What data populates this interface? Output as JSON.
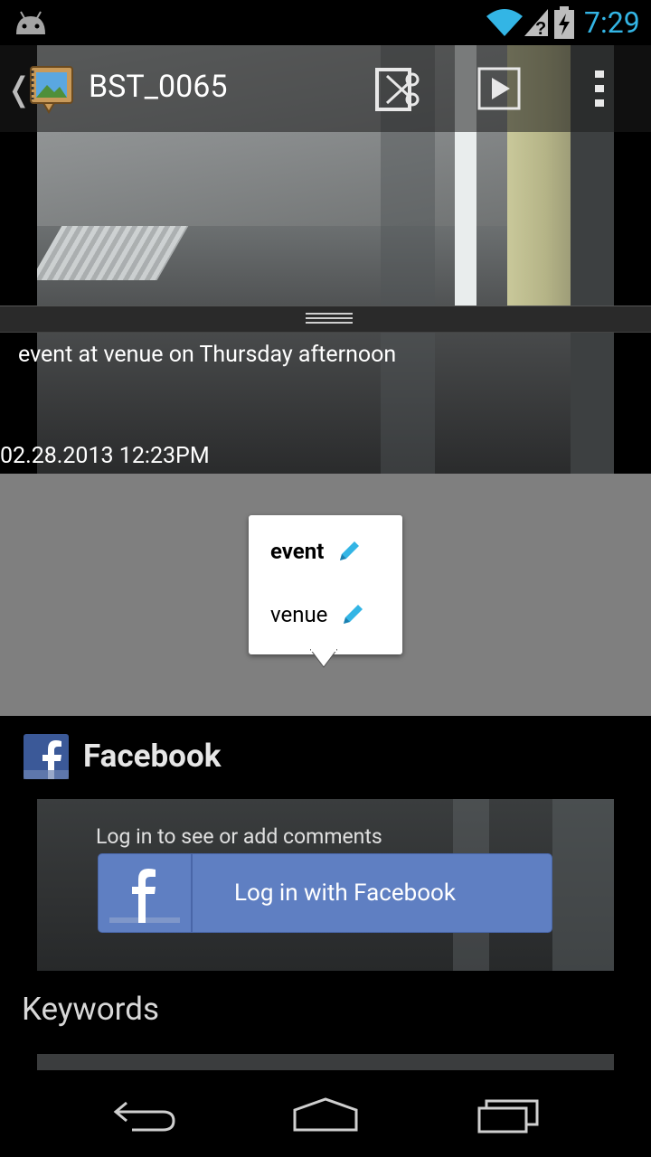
{
  "status_bar": {
    "time": "7:29"
  },
  "action_bar": {
    "title": "BST_0065",
    "back_glyph": "❬"
  },
  "photo": {
    "caption": "event at venue on Thursday afternoon",
    "datetime": "02.28.2013 12:23PM"
  },
  "tags": {
    "items": [
      {
        "label": "event",
        "bold": true
      },
      {
        "label": "venue",
        "bold": false
      }
    ]
  },
  "facebook": {
    "heading": "Facebook",
    "hint": "Log in to see or add comments",
    "login_label": "Log in with Facebook",
    "brand_color": "#3b5998",
    "button_color": "#5f7fc2"
  },
  "keywords": {
    "heading": "Keywords"
  },
  "colors": {
    "accent": "#33b5e5",
    "tag_area": "#7f7f7f"
  },
  "icons": [
    "android-icon",
    "wifi-icon",
    "signal-unknown-icon",
    "battery-charging-icon",
    "gallery-app-icon",
    "trim-video-icon",
    "play-icon",
    "overflow-menu-icon",
    "pencil-icon",
    "facebook-logo-icon",
    "back-nav-icon",
    "home-nav-icon",
    "recents-nav-icon"
  ]
}
